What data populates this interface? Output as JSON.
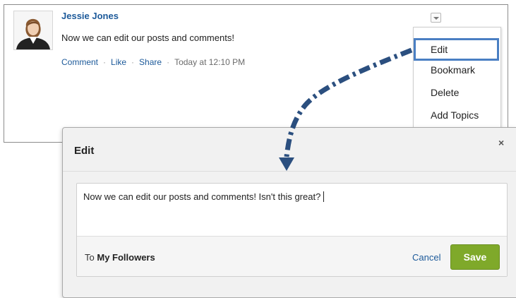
{
  "post": {
    "author": "Jessie Jones",
    "body": "Now we can edit our posts and comments!",
    "actions": {
      "comment": "Comment",
      "like": "Like",
      "share": "Share",
      "separator": "·",
      "timestamp": "Today at 12:10 PM"
    },
    "avatar_icon": "user-avatar-icon",
    "menu_trigger_icon": "chevron-down-icon"
  },
  "menu": {
    "items": [
      {
        "label": "Edit",
        "highlighted": true
      },
      {
        "label": "Bookmark"
      },
      {
        "label": "Delete"
      },
      {
        "label": "Add Topics"
      }
    ]
  },
  "modal": {
    "title": "Edit",
    "close_glyph": "×",
    "text": "Now we can edit our posts and comments! Isn't this great?",
    "audience_prefix": "To",
    "audience": "My Followers",
    "cancel_label": "Cancel",
    "save_label": "Save"
  },
  "colors": {
    "link": "#1d5a9a",
    "highlight_border": "#4a7fc3",
    "save_button": "#7fa92a",
    "arrow": "#2b4f7f"
  }
}
